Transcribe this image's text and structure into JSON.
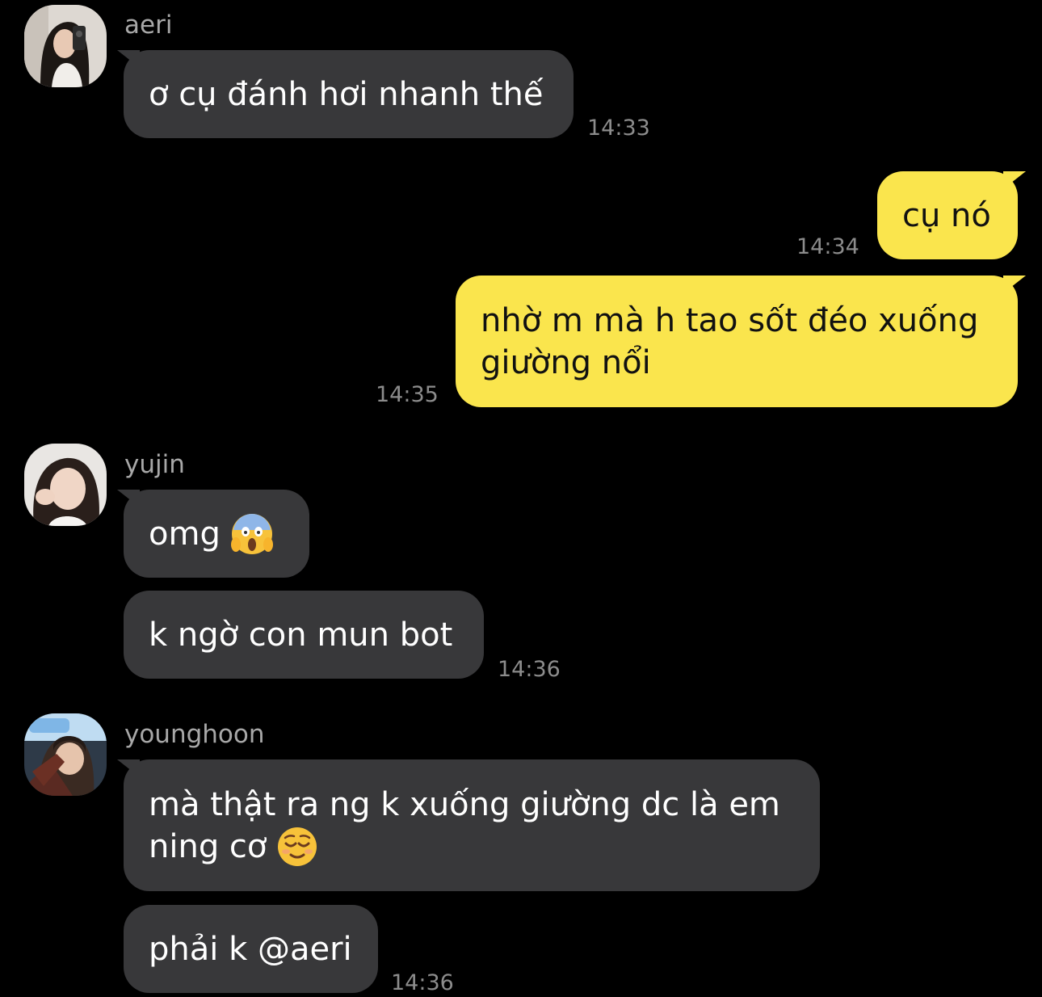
{
  "colors": {
    "background": "#000000",
    "incoming_bubble": "#38383a",
    "outgoing_bubble": "#fae54d",
    "sender_name": "#a8a8a8",
    "timestamp": "#8c8c8c"
  },
  "messages": {
    "aeri": {
      "sender": "aeri",
      "text1": "ơ cụ đánh hơi nhanh thế",
      "time1": "14:33"
    },
    "me": {
      "text1": "cụ nó",
      "time1": "14:34",
      "text2_line1": "nhờ m mà h tao sốt đéo xuống",
      "text2_line2": "giường nổi",
      "time2": "14:35"
    },
    "yujin": {
      "sender": "yujin",
      "text1": "omg",
      "text1_emoji": "screaming-face-emoji",
      "text2": "k ngờ con mun bot",
      "time2": "14:36"
    },
    "younghoon": {
      "sender": "younghoon",
      "text1_line1": "mà thật ra ng k xuống giường dc là em",
      "text1_line2": "ning cơ",
      "text1_emoji": "relieved-face-emoji",
      "text2": "phải k @aeri",
      "time2": "14:36"
    }
  }
}
